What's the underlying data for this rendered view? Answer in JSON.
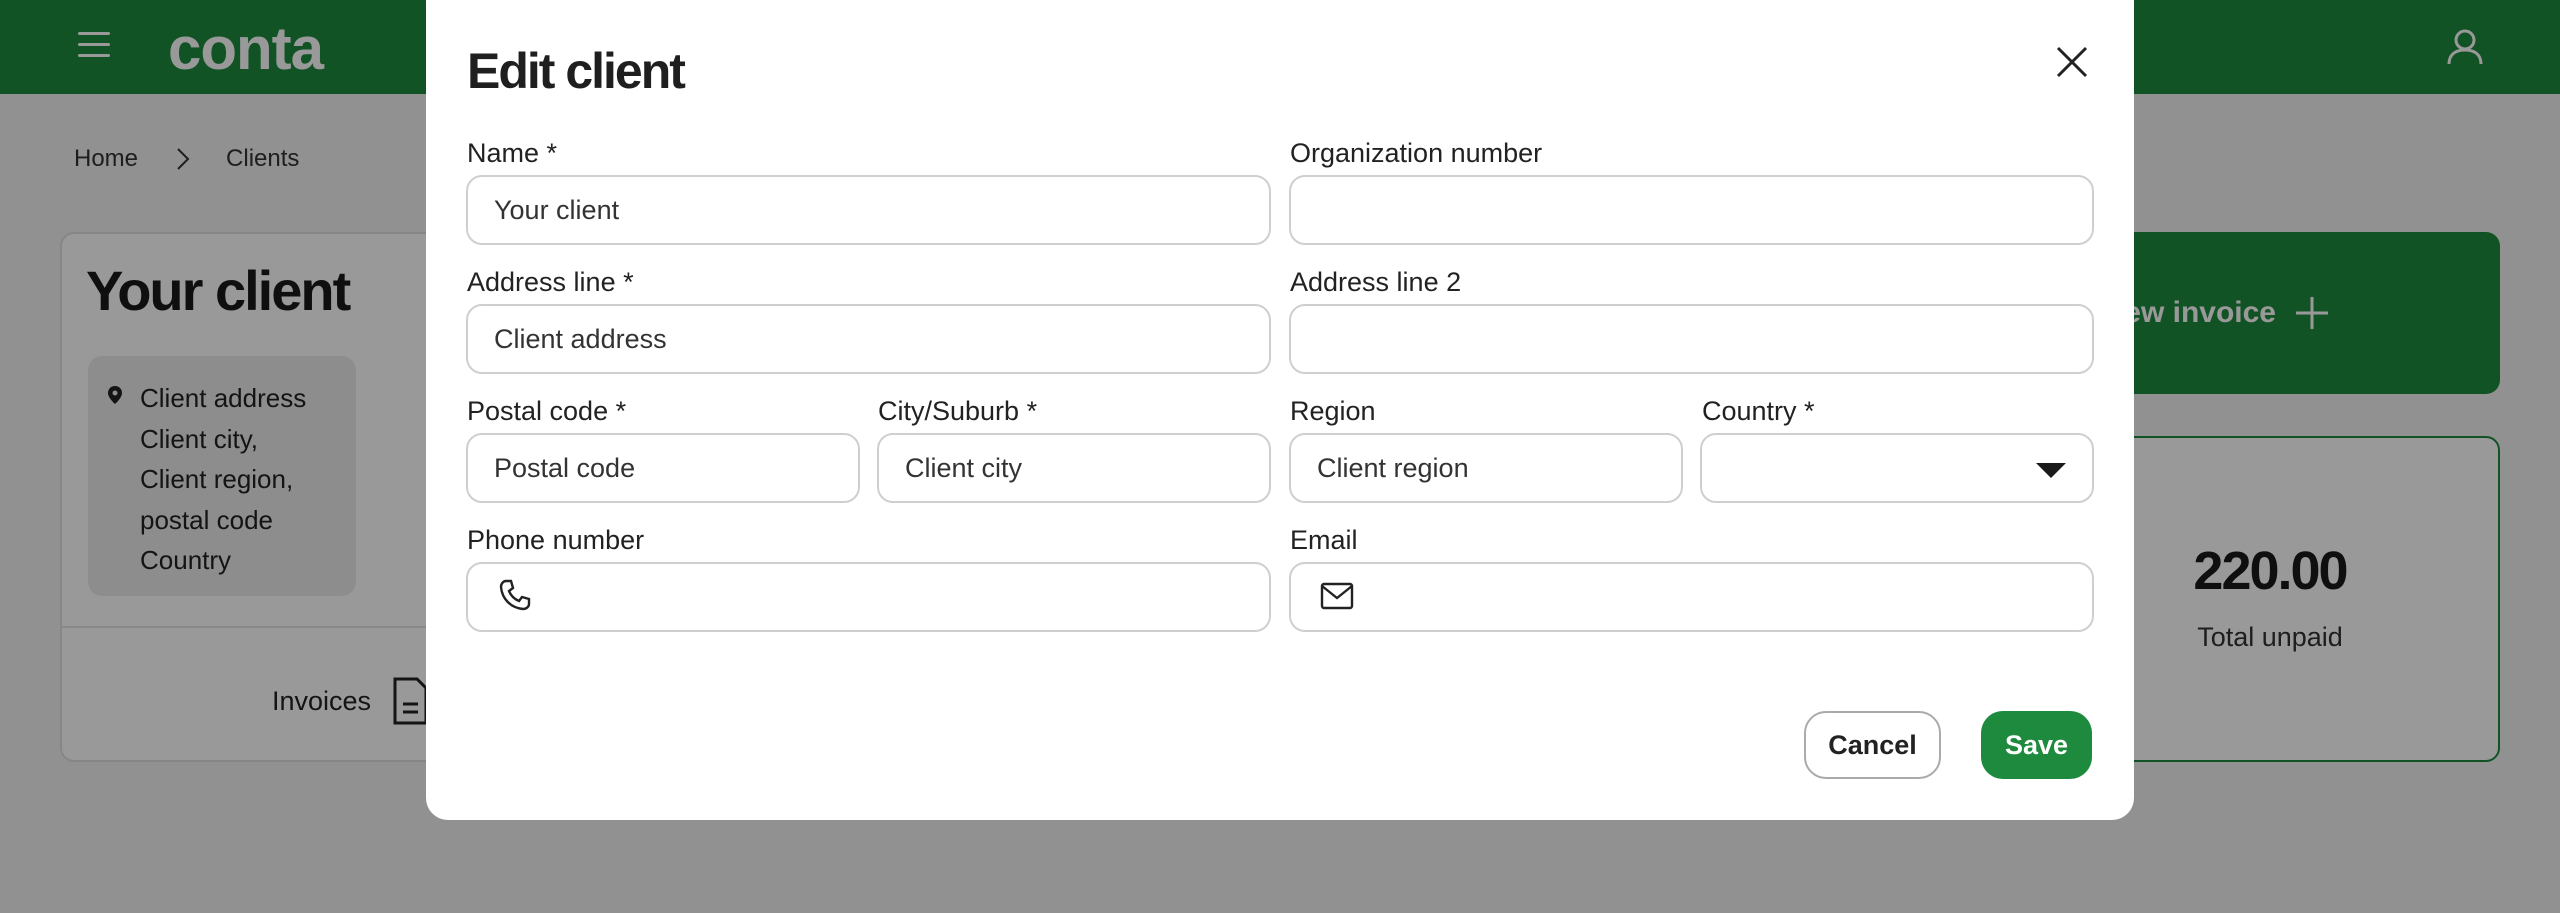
{
  "colors": {
    "brand": "#1e8a3e",
    "overlay": "rgba(0,0,0,0.40)"
  },
  "header": {
    "logo": "conta",
    "menu_icon": "hamburger-icon",
    "user_icon": "user-icon"
  },
  "breadcrumb": {
    "items": [
      "Home",
      "Clients"
    ]
  },
  "client": {
    "name": "Your client",
    "address_lines": [
      "Client address",
      "Client city,",
      "Client region,",
      "postal code",
      "Country"
    ],
    "invoices_label": "Invoices"
  },
  "new_invoice_label": "New invoice",
  "stats": {
    "total_unpaid_value": "220.00",
    "total_unpaid_label": "Total unpaid"
  },
  "modal": {
    "title": "Edit client",
    "fields": {
      "name": {
        "label": "Name *",
        "value": "Your client"
      },
      "org_number": {
        "label": "Organization number",
        "value": ""
      },
      "address_line": {
        "label": "Address line *",
        "value": "Client address"
      },
      "address_line2": {
        "label": "Address line 2",
        "value": ""
      },
      "postal_code": {
        "label": "Postal code *",
        "placeholder": "Postal code"
      },
      "city": {
        "label": "City/Suburb *",
        "value": "Client city"
      },
      "region": {
        "label": "Region",
        "value": "Client region"
      },
      "country": {
        "label": "Country *",
        "value": ""
      },
      "phone": {
        "label": "Phone number",
        "value": ""
      },
      "email": {
        "label": "Email",
        "value": ""
      }
    },
    "cancel_label": "Cancel",
    "save_label": "Save"
  }
}
